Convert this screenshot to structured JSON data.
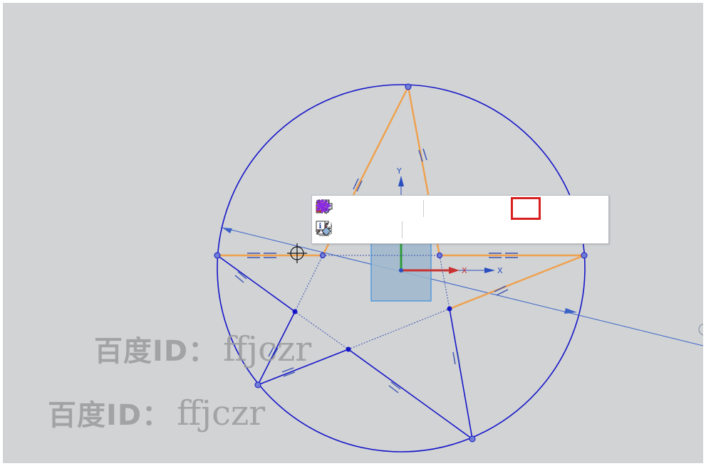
{
  "axes": {
    "y_label": "Y",
    "x_label": "X",
    "x_label_2": "X"
  },
  "watermark": {
    "text_cn": "百度ID：",
    "text_en": "ffjczr"
  },
  "toolbar": {
    "row1_icons": [
      "fully-constrained-icon",
      "alternate-solution-icon",
      "constraint-sketch-icon",
      "animate-dimension-icon",
      "delete-constraint-icon",
      "parallel-icon",
      "horizontal-icon",
      "vertical-icon",
      "collinear-icon",
      "equal-length-icon",
      "constant-angle-icon",
      "constant-length-icon",
      "perpendicular-icon"
    ],
    "row2_icons": [
      "angular-dimension-icon",
      "horizontal-dimension-icon",
      "vertical-dimension-icon",
      "parallel-dimension-icon",
      "sketch-info-icon"
    ],
    "selected_icon": "equal-length-icon"
  },
  "colors": {
    "background": "#d1d3d5",
    "circle": "#1515c8",
    "star_orange": "#f0a04b",
    "selection": "#d91f1f"
  }
}
